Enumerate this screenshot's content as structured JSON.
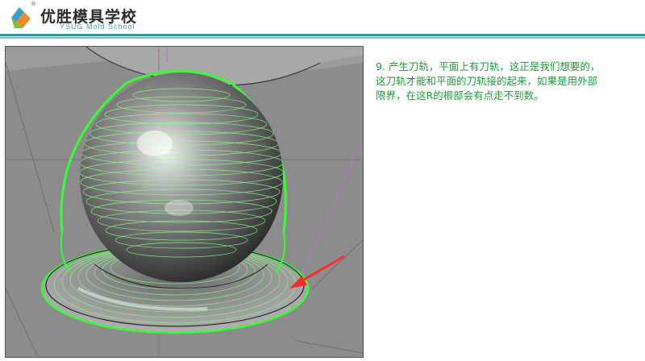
{
  "header": {
    "reg_mark": "®",
    "brand_cn": "优胜模具学校",
    "brand_en": "YSUG Mold School",
    "logo_icon": "ysug-logo-icon",
    "accent_color": "#3d8fb8"
  },
  "viewport": {
    "content": "3d-toolpath-preview",
    "toolpath_color": "#33ff33",
    "pointer_arrow": "red-arrow-icon"
  },
  "note": {
    "line1": "9. 产生刀轨，平面上有刀轨，这正是我们想要的，",
    "line2": "这刀轨才能和平面的刀轨接的起来，如果是用外部",
    "line3": "限界，在这R的根部会有点走不到数。",
    "text_color": "#1e9e3a"
  }
}
